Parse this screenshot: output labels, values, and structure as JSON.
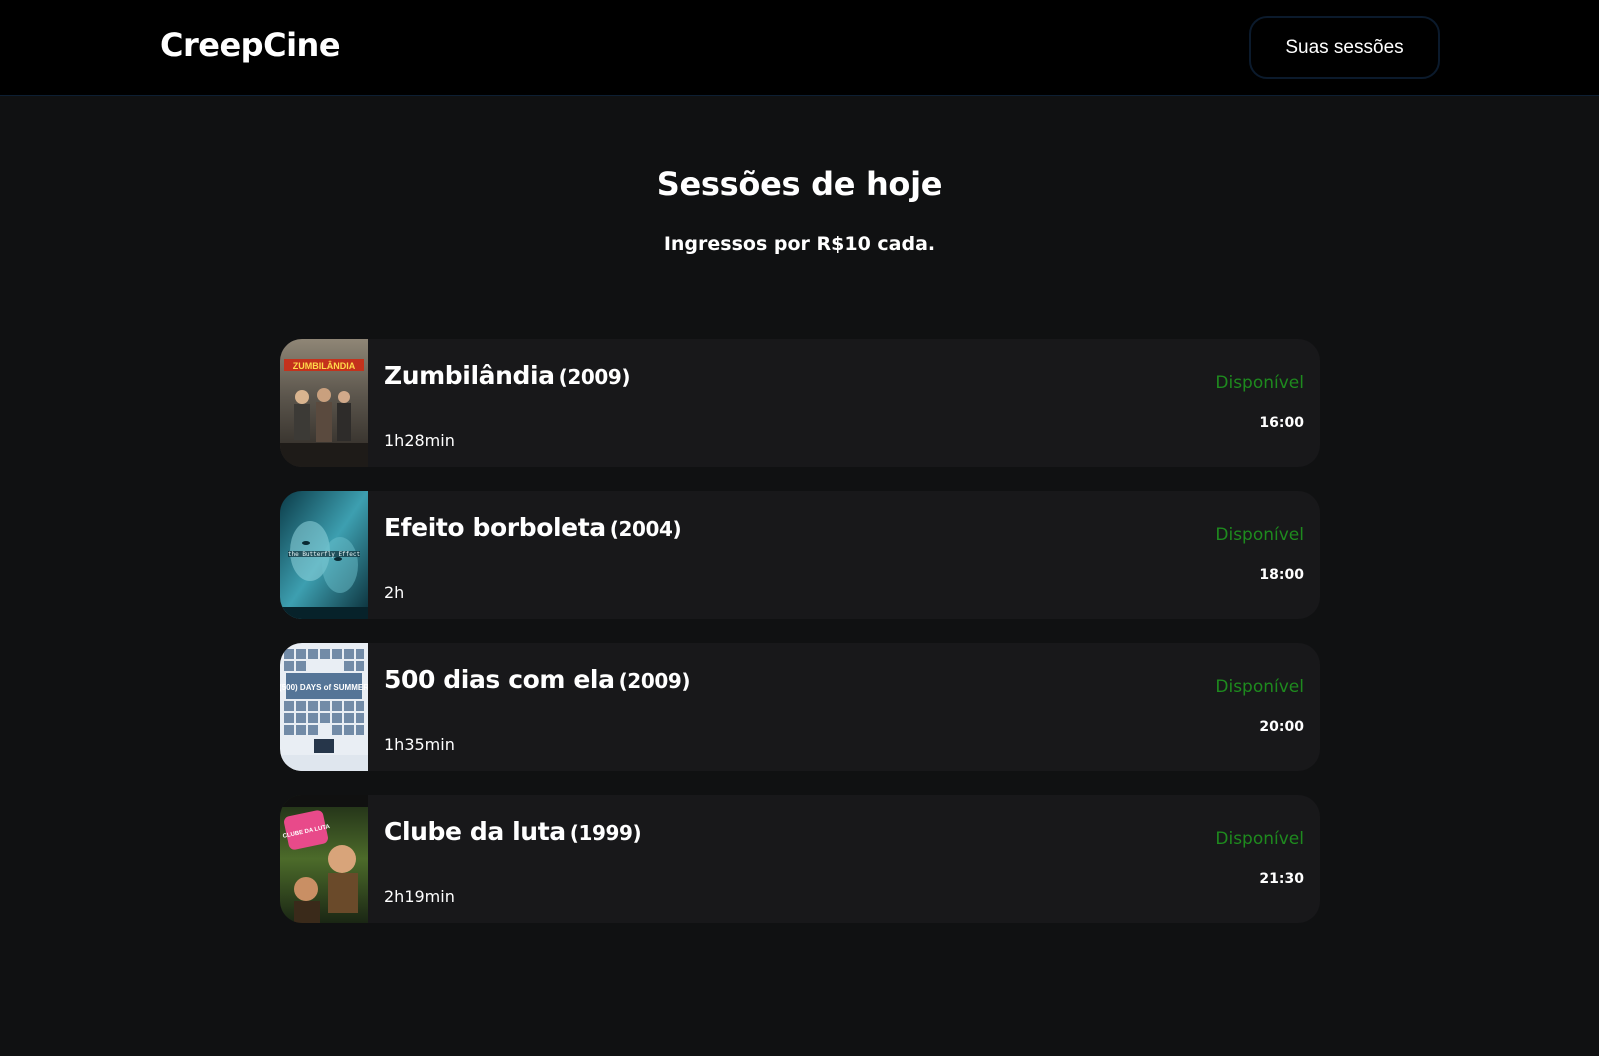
{
  "header": {
    "brand": "CreepCine",
    "sessions_button": "Suas sessões"
  },
  "main": {
    "title": "Sessões de hoje",
    "subtitle": "Ingressos por R$10 cada."
  },
  "sessions": [
    {
      "title": "Zumbilândia",
      "year": "(2009)",
      "duration": "1h28min",
      "status": "Disponível",
      "time": "16:00",
      "poster_text": "ZUMBILÂNDIA"
    },
    {
      "title": "Efeito borboleta",
      "year": "(2004)",
      "duration": "2h",
      "status": "Disponível",
      "time": "18:00",
      "poster_text": "the Butterfly Effect"
    },
    {
      "title": "500 dias com ela",
      "year": "(2009)",
      "duration": "1h35min",
      "status": "Disponível",
      "time": "20:00",
      "poster_text": "(500) DAYS of SUMMER"
    },
    {
      "title": "Clube da luta",
      "year": "(1999)",
      "duration": "2h19min",
      "status": "Disponível",
      "time": "21:30",
      "poster_text": "CLUBE DA LUTA"
    }
  ],
  "colors": {
    "background": "#101112",
    "topbar": "#000000",
    "card": "#18181a",
    "status_available": "#1e8a1e"
  }
}
